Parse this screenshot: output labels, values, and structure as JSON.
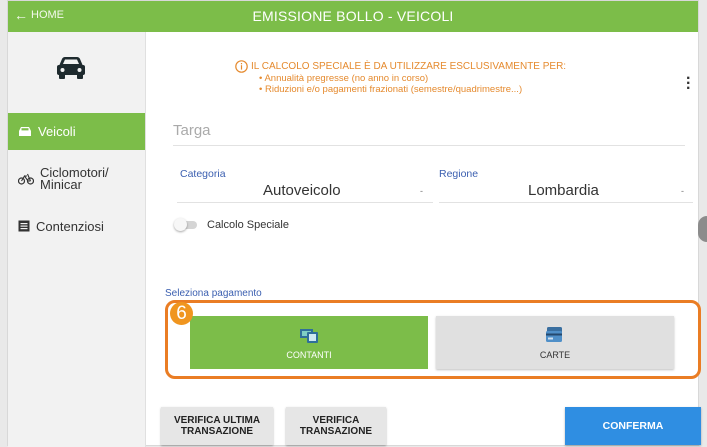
{
  "header": {
    "home_label": "HOME",
    "title": "EMISSIONE BOLLO - VEICOLI"
  },
  "sidebar": {
    "items": [
      {
        "label": "Veicoli",
        "icon": "car-icon",
        "active": true
      },
      {
        "label": "Ciclomotori/",
        "label2": "Minicar",
        "icon": "bicycle-icon",
        "active": false
      },
      {
        "label": "Contenziosi",
        "icon": "list-icon",
        "active": false
      }
    ]
  },
  "warning": {
    "heading": "IL CALCOLO SPECIALE È DA UTILIZZARE ESCLUSIVAMENTE PER:",
    "items": [
      "Annualità pregresse (no anno in corso)",
      "Riduzioni e/o pagamenti frazionati (semestre/quadrimestre...)"
    ],
    "color": "#e58a2e"
  },
  "form": {
    "targa_placeholder": "Targa",
    "categoria_label": "Categoria",
    "categoria_value": "Autoveicolo",
    "regione_label": "Regione",
    "regione_value": "Lombardia",
    "calcolo_speciale_label": "Calcolo Speciale",
    "calcolo_speciale_on": false
  },
  "payment": {
    "section_label": "Seleziona pagamento",
    "step_badge": "6",
    "cash_label": "CONTANTI",
    "card_label": "CARTE",
    "selected": "CONTANTI"
  },
  "actions": {
    "verifica_ultima_line1": "VERIFICA ULTIMA",
    "verifica_ultima_line2": "TRANSAZIONE",
    "verifica_line1": "VERIFICA",
    "verifica_line2": "TRANSAZIONE",
    "conferma": "CONFERMA"
  },
  "colors": {
    "accent_green": "#7cbd49",
    "confirm_blue": "#2f8ee2",
    "highlight_orange": "#ea7d24",
    "label_blue": "#3b5fb0"
  }
}
